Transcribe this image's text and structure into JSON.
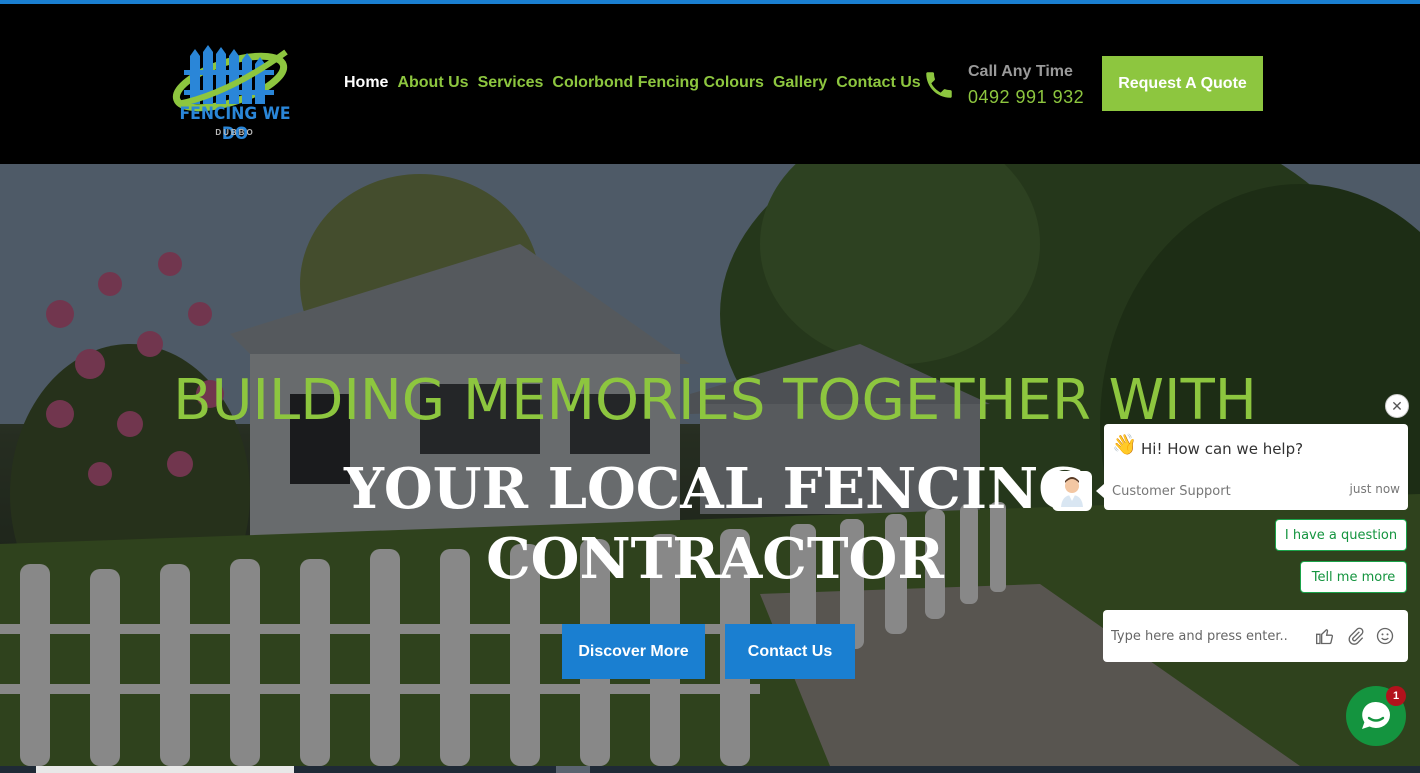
{
  "brand": {
    "logo_title": "FENCING WE DO",
    "logo_subtitle": "DUBBO",
    "primary_color": "#1a7fd1",
    "accent_color": "#8dc63f"
  },
  "nav": {
    "items": [
      {
        "label": "Home",
        "active": true
      },
      {
        "label": "About Us",
        "active": false
      },
      {
        "label": "Services",
        "active": false
      },
      {
        "label": "Colorbond Fencing Colours",
        "active": false
      },
      {
        "label": "Gallery",
        "active": false
      },
      {
        "label": "Contact Us",
        "active": false
      }
    ]
  },
  "call": {
    "icon": "phone-icon",
    "label": "Call Any Time",
    "number": "0492 991 932"
  },
  "quote_button": "Request A Quote",
  "hero": {
    "line1": "BUILDING MEMORIES TOGETHER WITH",
    "line2": "YOUR LOCAL FENCING",
    "line3": "CONTRACTOR",
    "discover_button": "Discover More",
    "contact_button": "Contact Us"
  },
  "chat": {
    "close_icon": "close-icon",
    "greeting": "Hi! How can we help?",
    "wave_icon": "waving-hand-icon",
    "agent": "Customer Support",
    "time": "just now",
    "chips": [
      "I have a question",
      "Tell me more"
    ],
    "input_placeholder": "Type here and press enter..",
    "input_icons": [
      "thumbs-up-icon",
      "attachment-icon",
      "emoji-icon"
    ],
    "unread_count": "1",
    "brand_color": "#14943f"
  }
}
